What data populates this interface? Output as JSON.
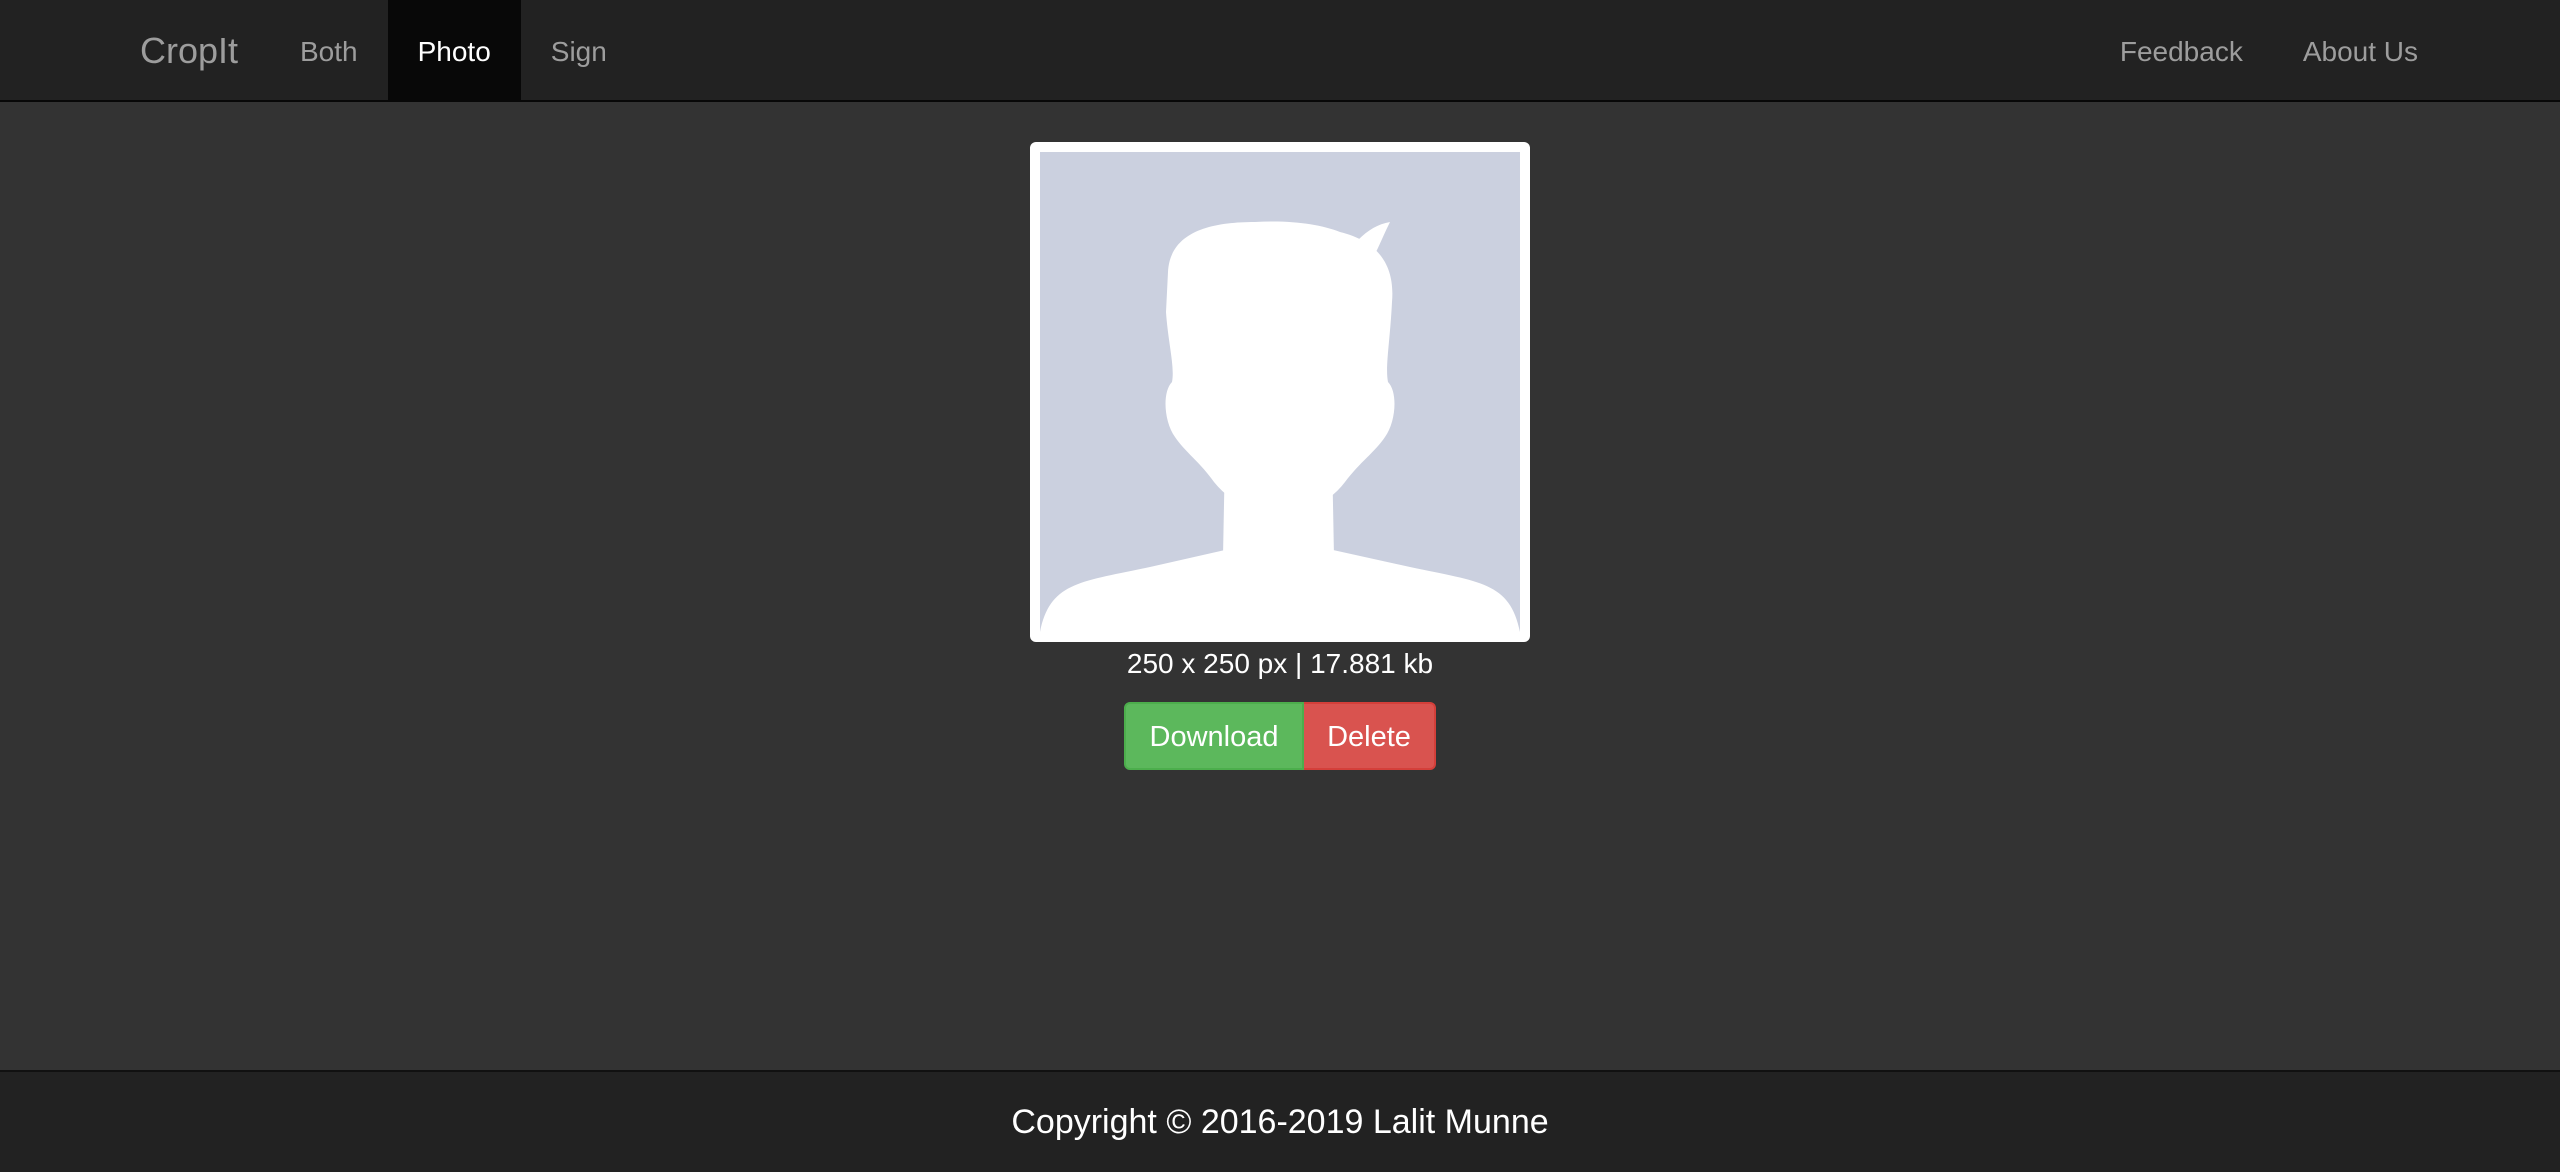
{
  "navbar": {
    "brand": "CropIt",
    "left_items": [
      {
        "label": "Both",
        "active": false
      },
      {
        "label": "Photo",
        "active": true
      },
      {
        "label": "Sign",
        "active": false
      }
    ],
    "right_items": [
      {
        "label": "Feedback"
      },
      {
        "label": "About Us"
      }
    ]
  },
  "main": {
    "photo": {
      "icon": "avatar-placeholder-icon",
      "placeholder_bg": "#cbd0df",
      "silhouette_color": "#ffffff"
    },
    "meta_text": "250 x 250 px | 17.881 kb",
    "buttons": {
      "download_label": "Download",
      "delete_label": "Delete"
    },
    "colors": {
      "download": "#5cb85c",
      "delete": "#d9534f"
    }
  },
  "footer": {
    "copyright": "Copyright © 2016-2019 Lalit Munne"
  }
}
